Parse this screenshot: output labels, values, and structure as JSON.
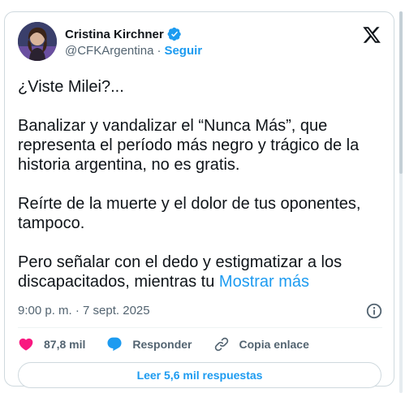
{
  "author": {
    "name": "Cristina Kirchner",
    "handle": "@CFKArgentina",
    "separator": "·",
    "follow_label": "Seguir"
  },
  "tweet": {
    "paragraph_1": "¿Viste Milei?...",
    "paragraph_2": "Banalizar y vandalizar el “Nunca Más”, que representa el período más negro y trágico de la historia argentina, no es gratis.",
    "paragraph_3": "Reírte de la muerte y el dolor de tus oponentes, tampoco.",
    "paragraph_4": "Pero señalar con el dedo y estigmatizar a los discapacitados, mientras tu",
    "show_more": "Mostrar más"
  },
  "meta": {
    "timestamp": "9:00 p. m. · 7 sept. 2025"
  },
  "actions": {
    "likes": "87,8 mil",
    "reply": "Responder",
    "copy_link": "Copia enlace"
  },
  "replies_button": "Leer 5,6 mil respuestas",
  "colors": {
    "accent": "#1d9bf0",
    "like": "#f91880",
    "text": "#0f1419",
    "secondary": "#536471",
    "border": "#cfd9de"
  },
  "icons": [
    "verified-badge-icon",
    "x-logo-icon",
    "info-icon",
    "heart-icon",
    "reply-bubble-icon",
    "link-icon"
  ]
}
